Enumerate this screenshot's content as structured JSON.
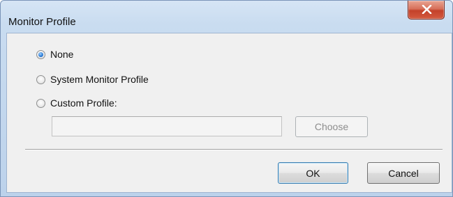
{
  "window": {
    "title": "Monitor Profile"
  },
  "titlebar": {
    "close_icon": "close-x-icon",
    "close_color": "#c3412a"
  },
  "options": [
    {
      "label": "None",
      "checked": true
    },
    {
      "label": "System Monitor Profile",
      "checked": false
    },
    {
      "label": "Custom Profile:",
      "checked": false
    }
  ],
  "custom_profile": {
    "value": "",
    "placeholder": "",
    "enabled": false,
    "choose_label": "Choose"
  },
  "footer": {
    "ok_label": "OK",
    "cancel_label": "Cancel"
  }
}
